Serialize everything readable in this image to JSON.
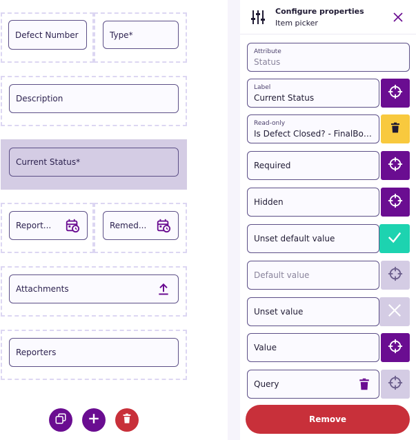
{
  "canvas": {
    "fields": {
      "defect_number": "Defect Number",
      "type": "Type*",
      "description": "Description",
      "current_status": "Current Status*",
      "reported": "Report...",
      "remediated": "Remed...",
      "attachments": "Attachments",
      "reporters": "Reporters"
    },
    "icons": {
      "calendar": "calendar-clock-icon",
      "upload": "upload-icon"
    }
  },
  "toolbar": {
    "copy": "copy-icon",
    "add": "add-icon",
    "delete": "delete-icon"
  },
  "panel": {
    "title": "Configure properties",
    "subtitle": "Item picker",
    "rows": {
      "attribute": {
        "caption": "Attribute",
        "value": "Status"
      },
      "label": {
        "caption": "Label",
        "value": "Current Status"
      },
      "read_only": {
        "caption": "Read-only",
        "value": "Is Defect Closed? - FinalBool..."
      },
      "required": "Required",
      "hidden": "Hidden",
      "unset_default": "Unset default value",
      "default_value": "Default value",
      "unset_value": "Unset value",
      "value": "Value",
      "query": "Query"
    },
    "remove": "Remove"
  },
  "colors": {
    "purple": "#6a0d91",
    "yellow": "#f8c93e",
    "teal": "#1dd3b0",
    "lilac": "#d4cce4",
    "red": "#c8303a"
  }
}
